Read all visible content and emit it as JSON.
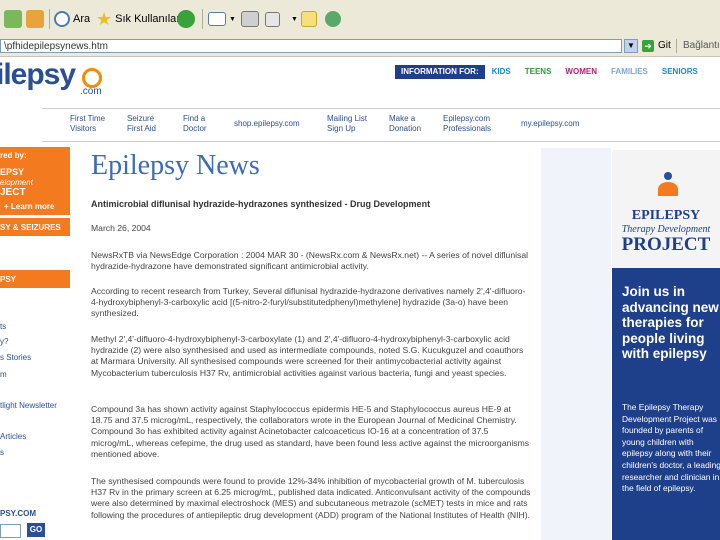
{
  "toolbar": {
    "search_label": "Ara",
    "favorites_label": "Sık Kullanılanlar"
  },
  "address_bar": {
    "url": "\\pfhidepilepsynews.htm",
    "go_label": "Git",
    "links_label": "Bağlantılar"
  },
  "site": {
    "logo_text": "ilepsy",
    "logo_com": ".com"
  },
  "info_bar": {
    "label": "INFORMATION FOR:",
    "links": [
      {
        "label": "KIDS",
        "color": "#1a8ad4"
      },
      {
        "label": "TEENS",
        "color": "#2a9a3a"
      },
      {
        "label": "WOMEN",
        "color": "#b0217a"
      },
      {
        "label": "FAMILIES",
        "color": "#7aa7d8"
      },
      {
        "label": "SENIORS",
        "color": "#1a8ad4"
      }
    ]
  },
  "nav": [
    {
      "line1": "First Time",
      "line2": "Visitors"
    },
    {
      "line1": "Seizure",
      "line2": "First Aid"
    },
    {
      "line1": "Find a",
      "line2": "Doctor"
    },
    {
      "line1": "shop.epilepsy.com",
      "line2": ""
    },
    {
      "line1": "Mailing List",
      "line2": "Sign Up"
    },
    {
      "line1": "Make a",
      "line2": "Donation"
    },
    {
      "line1": "Epilepsy.com",
      "line2": "Professionals"
    },
    {
      "line1": "my.epilepsy.com",
      "line2": ""
    }
  ],
  "left_sidebar": {
    "sponsor_line1": "red by:",
    "sponsor_line2": "EPSY",
    "sponsor_line3": "elopment",
    "sponsor_line4": "JECT",
    "learn_more": "+ Learn more",
    "section1": "SY & SEIZURES",
    "section2": "PSY",
    "links": [
      "ts",
      "y?",
      "s Stories",
      "m",
      "tlight Newsletter",
      "Articles",
      "s"
    ],
    "footer": "PSY.COM",
    "go_label": "GO"
  },
  "article": {
    "title": "Epilepsy News",
    "headline": "Antimicrobial diflunisal hydrazide-hydrazones synthesized - Drug Development",
    "date": "March 26, 2004",
    "paragraphs": [
      "NewsRxTB via NewsEdge Corporation : 2004 MAR 30 - (NewsRx.com & NewsRx.net) -- A series of novel diflunisal hydrazide-hydrazone have demonstrated significant antimicrobial activity.",
      "According to recent research from Turkey, Several diflunisal hydrazide-hydrazone derivatives namely 2',4'-difluoro-4-hydroxybiphenyl-3-carboxylic acid [(5-nitro-2-furyl/substitutedphenyl)methylene] hydrazide (3a-o) have been synthesized.",
      "Methyl 2',4'-difluoro-4-hydroxybiphenyl-3-carboxylate (1) and 2',4'-difluoro-4-hydroxybiphenyl-3-carboxylic acid hydrazide (2) were also synthesised and used as intermediate compounds, noted S.G. Kucukguzel and coauthors at Marmara University. All synthesised compounds were screened for their antimycobacterial activity against Mycobacterium tuberculosis H37 Rv, antimicrobial activities against various bacteria, fungi and yeast species.",
      "Compound 3a has shown activity against Staphylococcus epidermis HE-5 and Staphylococcus aureus HE-9 at 18.75 and 37.5 microg/mL, respectively, the collaborators wrote in the European Journal of Medicinal Chemistry. Compound 3o has exhibited activity against Acinetobacter calcoaceticus IO-16 at a concentration of 37.5 microg/mL, whereas cefepime, the drug used as standard, have been found less active against the microorganisms mentioned above.",
      "The synthesised compounds were found to provide 12%-34% inhibition of mycobacterial growth of M. tuberculosis H37 Rv in the primary screen at 6.25 microg/mL, published data indicated. Anticonvulsant activity of the compounds were also determined by maximal electroshock (MES) and subcutaneous metrazole (scMET) tests in mice and rats following the procedures of antiepileptic drug development (ADD) program of the National Institutes of Health (NIH)."
    ]
  },
  "right_sidebar": {
    "epilepsy": "EPILEPSY",
    "therapy_development": "Therapy Development",
    "project": "PROJECT",
    "join": "Join us in advancing new therapies for people living with epilepsy",
    "description": "The Epilepsy Therapy Development Project was founded by parents of young children with epilepsy along with their children's doctor, a leading researcher and clinician in the field of epilepsy."
  }
}
